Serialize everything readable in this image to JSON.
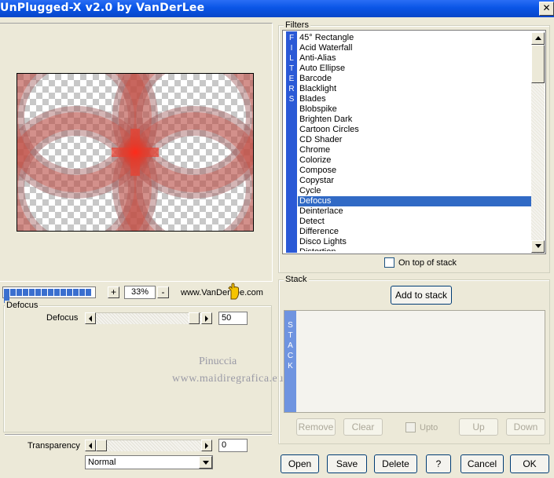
{
  "window": {
    "title": "UnPlugged-X v2.0 by VanDerLee",
    "close_label": "✕"
  },
  "preview": {
    "progress_segments": 15,
    "zoom_minus": "-",
    "zoom_plus": "+",
    "zoom_level": "33%",
    "url": "www.VanDerLee.com"
  },
  "filter_settings": {
    "group_label": "Defocus",
    "defocus_label": "Defocus",
    "defocus_value": "50",
    "transparency_label": "Transparency",
    "transparency_value": "0",
    "blend_mode": "Normal"
  },
  "watermark": {
    "line1": "Pinuccia",
    "line2": "www.maidiregrafica.eu"
  },
  "filters": {
    "group_label": "Filters",
    "strip_letters": [
      "F",
      "I",
      "L",
      "T",
      "E",
      "R",
      "S"
    ],
    "items": [
      "45° Rectangle",
      "Acid Waterfall",
      "Anti-Alias",
      "Auto Ellipse",
      "Barcode",
      "Blacklight",
      "Blades",
      "Blobspike",
      "Brighten Dark",
      "Cartoon Circles",
      "CD Shader",
      "Chrome",
      "Colorize",
      "Compose",
      "Copystar",
      "Cycle",
      "Defocus",
      "Deinterlace",
      "Detect",
      "Difference",
      "Disco Lights",
      "Distortion"
    ],
    "selected": "Defocus",
    "on_top_label": "On top of stack"
  },
  "stack": {
    "group_label": "Stack",
    "add_button": "Add to stack",
    "strip_letters": [
      "S",
      "T",
      "A",
      "C",
      "K"
    ],
    "remove_button": "Remove",
    "clear_button": "Clear",
    "upto_label": "Upto",
    "up_button": "Up",
    "down_button": "Down"
  },
  "footer": {
    "open": "Open",
    "save": "Save",
    "delete": "Delete",
    "help": "?",
    "cancel": "Cancel",
    "ok": "OK"
  },
  "colors": {
    "titlebar": "#0a55e6",
    "selection": "#316ac5",
    "filters_strip": "#2a59d6",
    "stack_strip": "#6f94e0",
    "progress": "#3a6fcf"
  }
}
